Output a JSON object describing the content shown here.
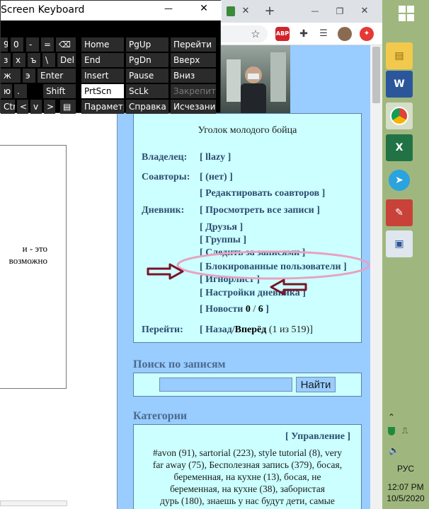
{
  "browser": {
    "tab_close": "✕",
    "new_tab": "+",
    "minimize": "—",
    "restore": "❐",
    "close": "✕",
    "abp_label": "ABP"
  },
  "keyboard": {
    "title": "Screen Keyboard",
    "minimize": "—",
    "close": "✕",
    "letter_keys": [
      "9",
      "0",
      "-",
      "=",
      "⌫",
      "з",
      "х",
      "ъ",
      "\\",
      "Del",
      "ж",
      "э",
      "Enter",
      "ю",
      ".",
      "Shift",
      "Ctr",
      "<",
      "v",
      ">",
      "▤"
    ],
    "nav_keys": [
      "Home",
      "PgUp",
      "Перейти",
      "End",
      "PgDn",
      "Вверх",
      "Insert",
      "Pause",
      "Вниз",
      "PrtScn",
      "ScLk",
      "Закрепить",
      "Параметры",
      "Справка",
      "Исчезание"
    ]
  },
  "left": {
    "line1": "и - это",
    "line2": "возможно"
  },
  "profile": {
    "caption": "Уголок молодого бойца",
    "owner_label": "Владелец:",
    "owner_value": "[ llazy ]",
    "coauthors_label": "Соавторы:",
    "coauthors_value": "[ (нет) ]",
    "edit_coauthors": "[ Редактировать соавторов ]",
    "diary_label": "Дневник:",
    "view_all": "[ Просмотреть все записи ]",
    "friends": "[ Друзья ]",
    "groups": "[ Группы ]",
    "follow": "[ Следить за записями ]",
    "blocked": "[ Блокированные пользователи ]",
    "ignore": "[ Игнорлист ]",
    "diary_settings": "[ Настройки дневника ]",
    "news_open": "[ Новости ",
    "news_count": "0",
    "news_sep": " / ",
    "news_total": "6",
    "news_close": " ]",
    "goto_label": "Перейти:",
    "goto_back": "[ Назад/",
    "goto_forward": "Вперёд",
    "goto_count": " (1 из 519)]"
  },
  "search": {
    "title": "Поиск по записям",
    "button": "Найти",
    "value": ""
  },
  "categories": {
    "title": "Категории",
    "manage": "[ Управление ]",
    "lines": [
      "#avon (91), sartorial (223), style tutorial (8), very",
      "far away (75), Бесполезная запись (379), босая,",
      "беременная, на кухне (13), босая, не",
      "беременная, на кухне (38), забористая",
      "дурь (180), знаешь у нас будут дети, самые"
    ]
  },
  "taskbar": {
    "lang": "РУС",
    "time": "12:07 PM",
    "date": "10/5/2020"
  },
  "colors": {
    "page_bg": "#99ccff",
    "panel_bg": "#ccffff",
    "link": "#2d4d70",
    "arrow": "#7a1424",
    "ellipse": "#e8a2c0"
  }
}
